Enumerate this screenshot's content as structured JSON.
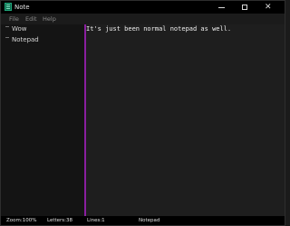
{
  "window": {
    "title": "Note",
    "icon": "notepad-app-icon",
    "controls": [
      "minimize-icon",
      "maximize-icon",
      "close-icon"
    ],
    "close_glyph": "✕"
  },
  "menu": {
    "items": [
      {
        "label": "File"
      },
      {
        "label": "Edit"
      },
      {
        "label": "Help"
      }
    ]
  },
  "sidebar": {
    "notes": [
      {
        "label": "Wow"
      },
      {
        "label": "Notepad"
      }
    ]
  },
  "editor": {
    "content": "It's just been normal notepad as well."
  },
  "status": {
    "zoom": "Zoom:100%",
    "letters": "Letters:38",
    "lines": "Lines:1",
    "mode": "Notepad"
  },
  "colors": {
    "accent_divider": "#8a1fa0",
    "titlebar": "#000000",
    "sidebar_bg": "#141414",
    "editor_bg": "#1e1e1e"
  }
}
